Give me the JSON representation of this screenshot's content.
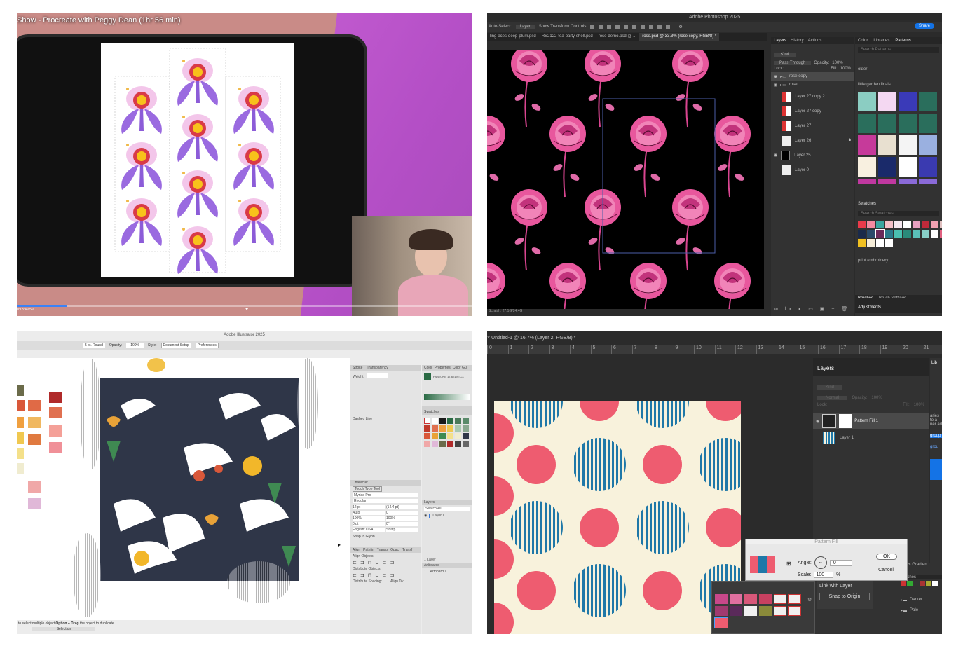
{
  "procreate": {
    "video_title": "Show - Procreate with Peggy Dean (1hr 56 min)",
    "time": "0:13:49:59"
  },
  "photoshop1": {
    "app_title": "Adobe Photoshop 2025",
    "options": [
      "Auto-Select:",
      "Layer",
      "Show Transform Controls"
    ],
    "share": "Share",
    "doc_tabs": [
      "ling-aces-deep-plum.psd",
      "RS2122-tea-party-shell.psd",
      "rose-demo.psd @ ...",
      "rose.psd @ 33.3% (rose copy, RGB/8) *"
    ],
    "layers_tabs": [
      "Layers",
      "History",
      "Actions"
    ],
    "kind": "Kind",
    "blend": "Pass Through",
    "opacity_label": "Opacity:",
    "opacity": "100%",
    "lock_label": "Lock:",
    "fill_label": "Fill:",
    "fill": "100%",
    "layers": [
      "rose copy",
      "rose",
      "Layer 27 copy 2",
      "Layer 27 copy",
      "Layer 27",
      "Layer 26",
      "Layer 25",
      "Layer 0"
    ],
    "right_tabs": [
      "Color",
      "Libraries",
      "Patterns"
    ],
    "search_patterns": "Search Patterns",
    "groups": [
      "older",
      "little garden finals"
    ],
    "swatches_title": "Swatches",
    "search_swatches": "Search Swatches",
    "group_embroidery": "print embroidery",
    "bottom_tabs": [
      "Brushes",
      "Brush Settings"
    ],
    "adjustments": "Adjustments",
    "status": "Scratch: 27.1G/24.4G"
  },
  "illustrator": {
    "app_title": "Adobe Illustrator 2025",
    "toolbar": [
      "5 pt. Round",
      "Opacity:",
      "100%",
      "Style:",
      "Document Setup",
      "Preferences"
    ],
    "stroke_tabs": [
      "Stroke",
      "Transparency"
    ],
    "weight": "Weight:",
    "dashed": "Dashed Line",
    "color_tabs": [
      "Color",
      "Properties",
      "Color Gu"
    ],
    "pantone": "PANTONE 17-6219 TCX",
    "swatches": "Swatches",
    "character": "Character",
    "touch_type": "Touch Type Tool",
    "font": "Myriad Pro",
    "style": "Regular",
    "font_size": "12 pt",
    "leading": "(14.4 pt)",
    "kern": "Auto",
    "track": "0",
    "scale_v": "100%",
    "scale_h": "100%",
    "baseline": "0 pt",
    "rotate": "0°",
    "language": "English: USA",
    "aa": "Sharp",
    "snap": "Snap to Glyph",
    "align_tabs": [
      "Align",
      "Pathfin",
      "Transp",
      "Opaci",
      "Transf"
    ],
    "align_objects": "Align Objects:",
    "distribute_objects": "Distribute Objects:",
    "distribute_spacing": "Distribute Spacing:",
    "align_to": "Align To:",
    "layers_tab": "Layers",
    "search_all": "Search All",
    "layer_name": "Layer 1",
    "artboards_tab": "Artboards",
    "artboard_num": "1",
    "artboard_name": "Artboard 1",
    "layer_count": "1 Layer",
    "status_hint": "to select multiple object",
    "status_option": "Option + Drag",
    "status_rest": "the object to duplicate",
    "zoom": "Selection"
  },
  "photoshop2": {
    "doc_tab": "Untitled-1 @ 16.7% (Layer 2, RGB/8) *",
    "ruler": [
      "0",
      "1",
      "2",
      "3",
      "4",
      "5",
      "6",
      "7",
      "8",
      "9",
      "10",
      "11",
      "12",
      "13",
      "14",
      "15",
      "16",
      "17",
      "18",
      "19",
      "20",
      "21"
    ],
    "layers_title": "Layers",
    "libraries_title": "Lib",
    "kind": "Kind",
    "blend": "Normal",
    "opacity_label": "Opacity:",
    "opacity": "100%",
    "lock_label": "Lock:",
    "fill_label": "Fill:",
    "fill": "100%",
    "layers": [
      "Pattern Fill 1",
      "Layer 1"
    ],
    "dialog_title": "Pattern Fill",
    "angle_label": "Angle:",
    "angle": "0",
    "scale_label": "Scale:",
    "scale": "100",
    "percent": "%",
    "link": "Link with Layer",
    "snap": "Snap to Origin",
    "ok": "OK",
    "cancel": "Cancel",
    "side_text": [
      "aries",
      "to a",
      "ner ad",
      "group",
      "grou"
    ],
    "tabs2": [
      "tches",
      "Gradien"
    ],
    "swatches2": "watches",
    "folders": [
      "Darker",
      "Pale"
    ]
  },
  "colors": {
    "pink": "#e4579a",
    "navy": "#2f3648",
    "blue": "#1f78a8",
    "coral": "#ee5c70",
    "cream": "#f8f2dc",
    "purple": "#9a6ae0",
    "accent": "#1473e6"
  }
}
